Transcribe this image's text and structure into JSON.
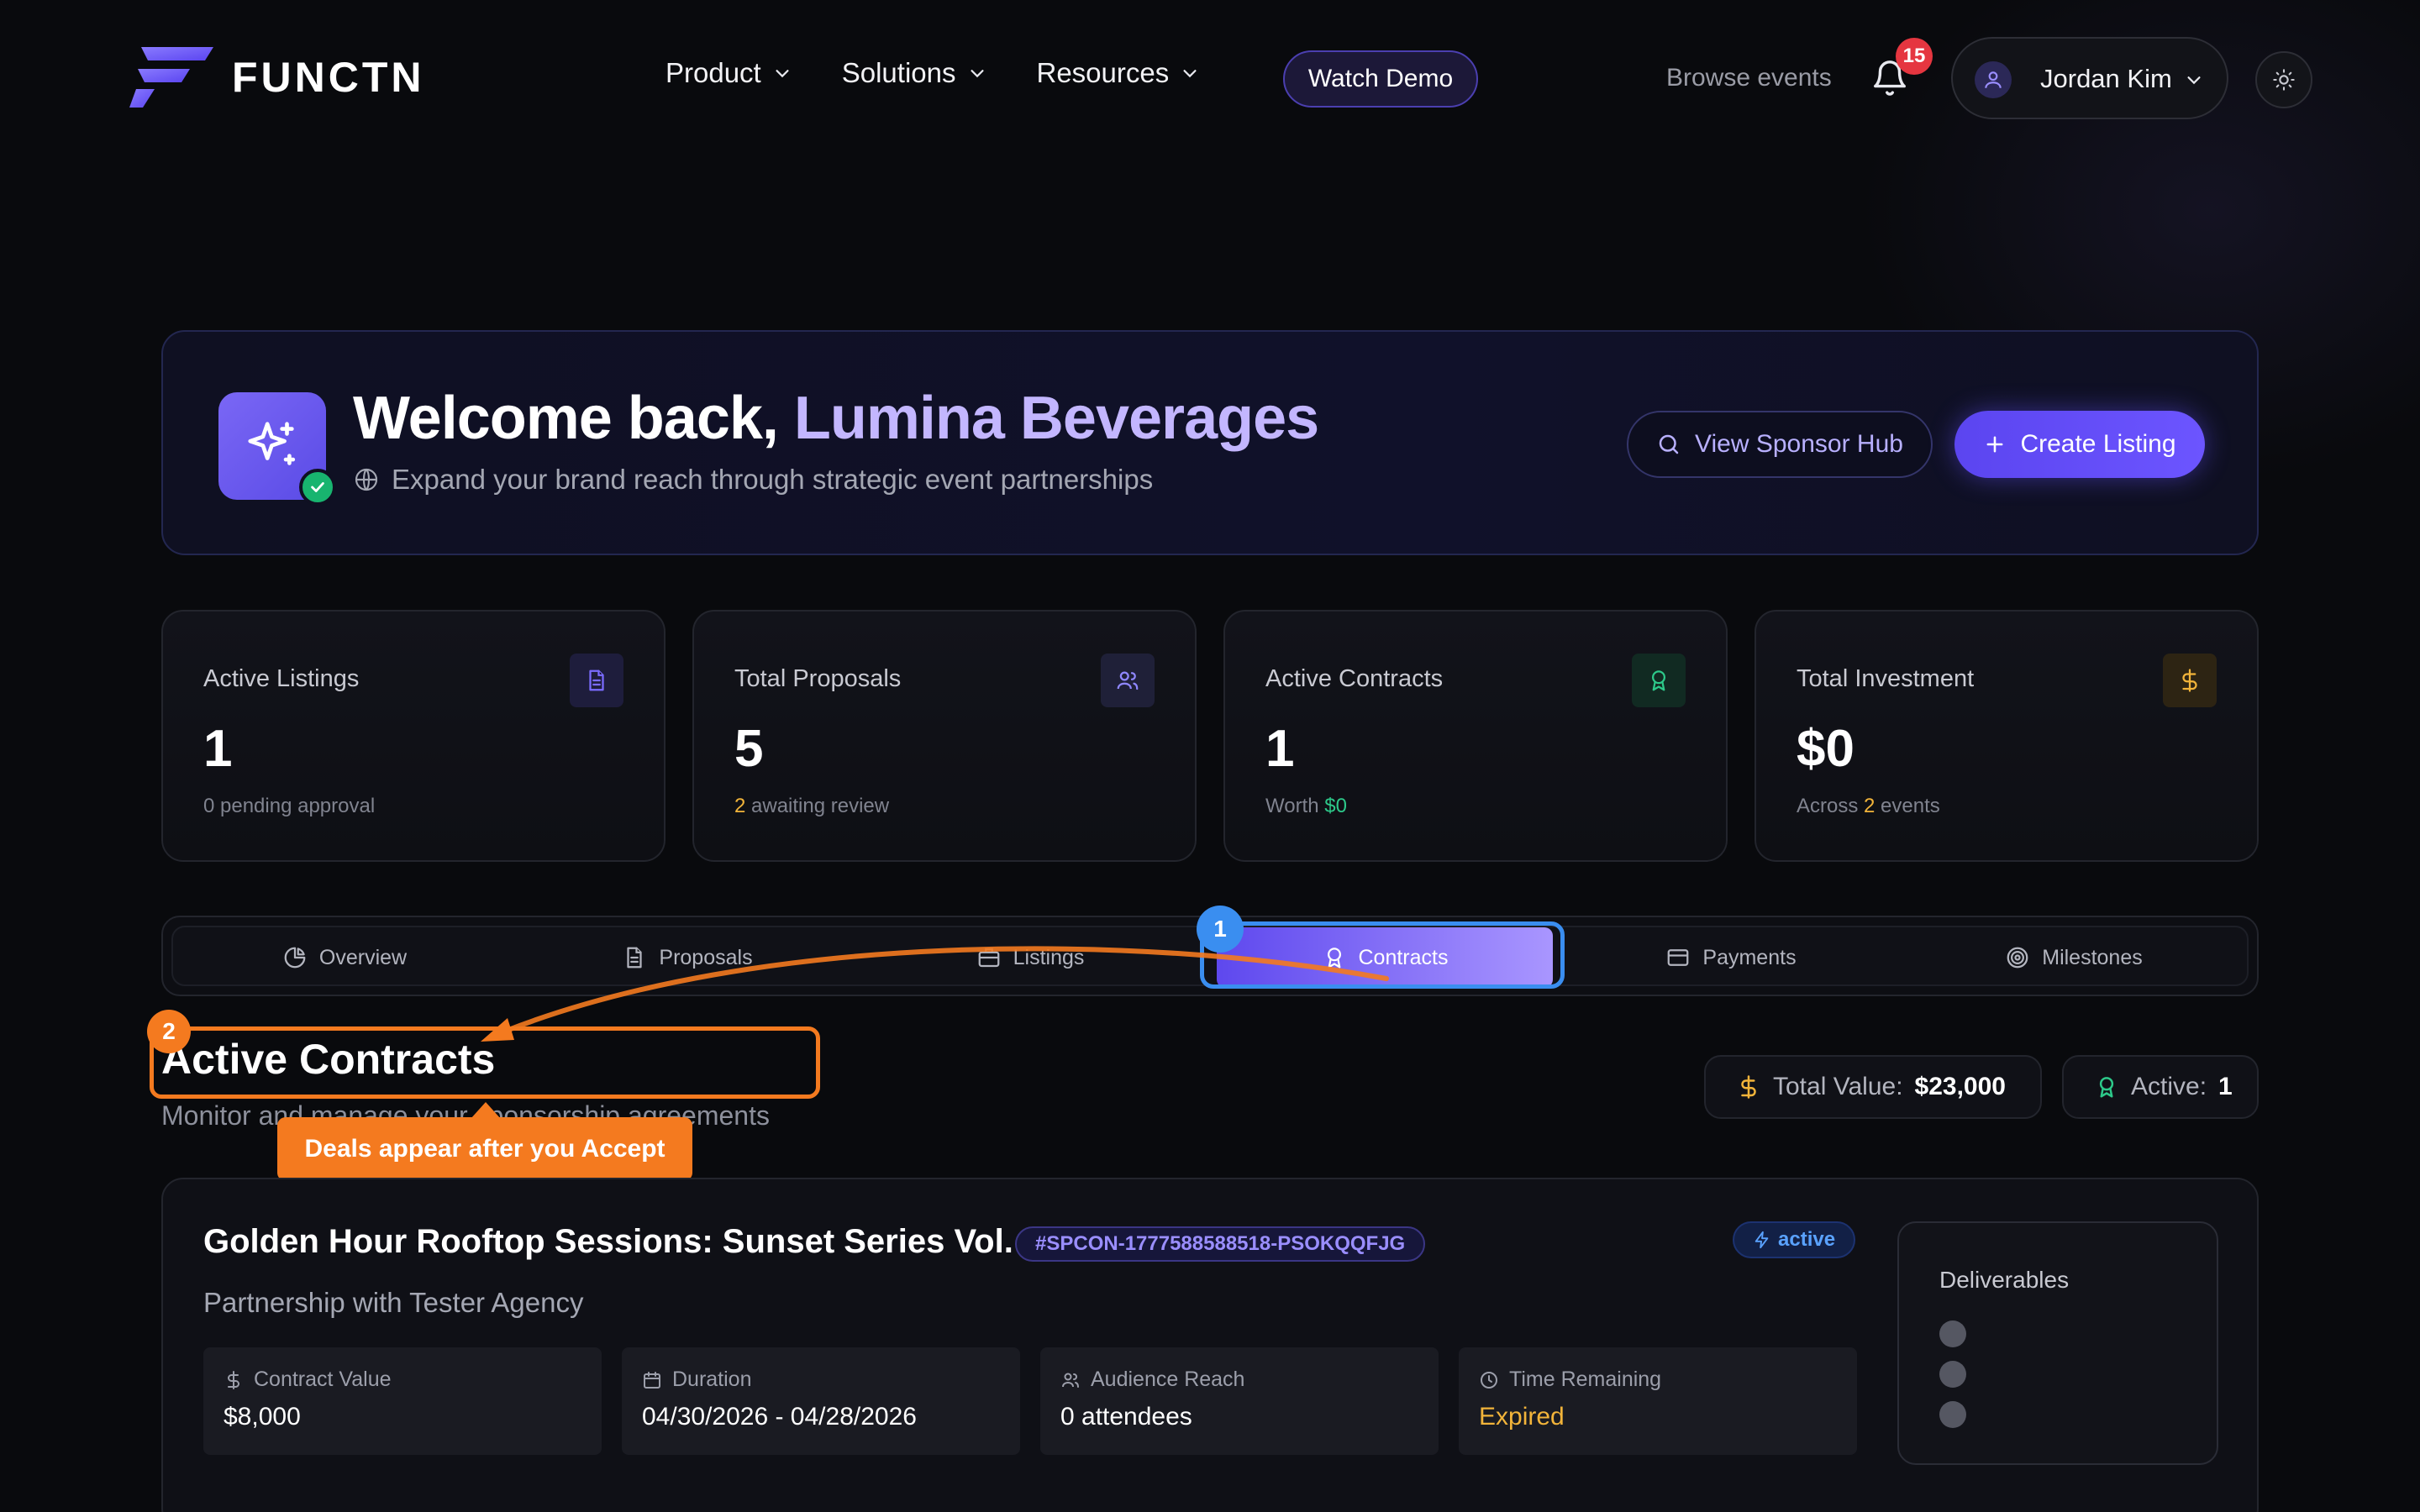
{
  "brand": {
    "name": "FUNCTN",
    "accent": "#6c55ff"
  },
  "nav": {
    "items": [
      {
        "label": "Product",
        "icon": "chevron-down-icon"
      },
      {
        "label": "Solutions",
        "icon": "chevron-down-icon"
      },
      {
        "label": "Resources",
        "icon": "chevron-down-icon"
      }
    ],
    "watch_demo": "Watch Demo",
    "browse_events": "Browse events",
    "notifications_count": "15",
    "user_name": "Jordan Kim"
  },
  "welcome": {
    "greeting": "Welcome back, ",
    "company": "Lumina Beverages",
    "subtitle": "Expand your brand reach through strategic event partnerships",
    "view_hub": "View Sponsor Hub",
    "create_listing": "Create Listing"
  },
  "stats": [
    {
      "label": "Active Listings",
      "value": "1",
      "sub_pre": "0 pending approval",
      "sub_hl": "",
      "sub_post": "",
      "icon": "document-icon",
      "color": "#7b6cff"
    },
    {
      "label": "Total Proposals",
      "value": "5",
      "sub_pre": "",
      "sub_hl": "2",
      "sub_post": " awaiting review",
      "icon": "users-icon",
      "color": "#8f87ff"
    },
    {
      "label": "Active Contracts",
      "value": "1",
      "sub_pre": "Worth ",
      "sub_hl": "$0",
      "sub_post": "",
      "icon": "award-icon",
      "color": "#2dc98a"
    },
    {
      "label": "Total Investment",
      "value": "$0",
      "sub_pre": "Across ",
      "sub_hl": "2",
      "sub_post": " events",
      "icon": "dollar-icon",
      "color": "#f2b43a"
    }
  ],
  "tabs": [
    {
      "label": "Overview",
      "icon": "pie-chart-icon",
      "active": false
    },
    {
      "label": "Proposals",
      "icon": "document-icon",
      "active": false
    },
    {
      "label": "Listings",
      "icon": "briefcase-icon",
      "active": false
    },
    {
      "label": "Contracts",
      "icon": "award-icon",
      "active": true
    },
    {
      "label": "Payments",
      "icon": "credit-card-icon",
      "active": false
    },
    {
      "label": "Milestones",
      "icon": "target-icon",
      "active": false
    }
  ],
  "walkthrough": {
    "step1": "1",
    "step2": "2",
    "tooltip": "Deals appear after you Accept",
    "colors": {
      "step1": "#3a8ef0",
      "step2": "#f47a1f"
    }
  },
  "section": {
    "title": "Active Contracts",
    "subtitle": "Monitor and manage your sponsorship agreements",
    "total_label": "Total Value:",
    "total_value": "$23,000",
    "active_label": "Active:",
    "active_value": "1"
  },
  "contract": {
    "title": "Golden Hour Rooftop Sessions: Sunset Series Vol. 1",
    "id": "#SPCON-1777588588518-PSOKQQFJG",
    "status": "active",
    "partner": "Partnership with Tester Agency",
    "metrics": [
      {
        "label": "Contract Value",
        "value": "$8,000",
        "icon": "dollar-icon"
      },
      {
        "label": "Duration",
        "value": "04/30/2026 - 04/28/2026",
        "icon": "calendar-icon"
      },
      {
        "label": "Audience Reach",
        "value": "0 attendees",
        "icon": "users-icon"
      },
      {
        "label": "Time Remaining",
        "value": "Expired",
        "icon": "clock-icon"
      }
    ],
    "deliverables_title": "Deliverables"
  }
}
